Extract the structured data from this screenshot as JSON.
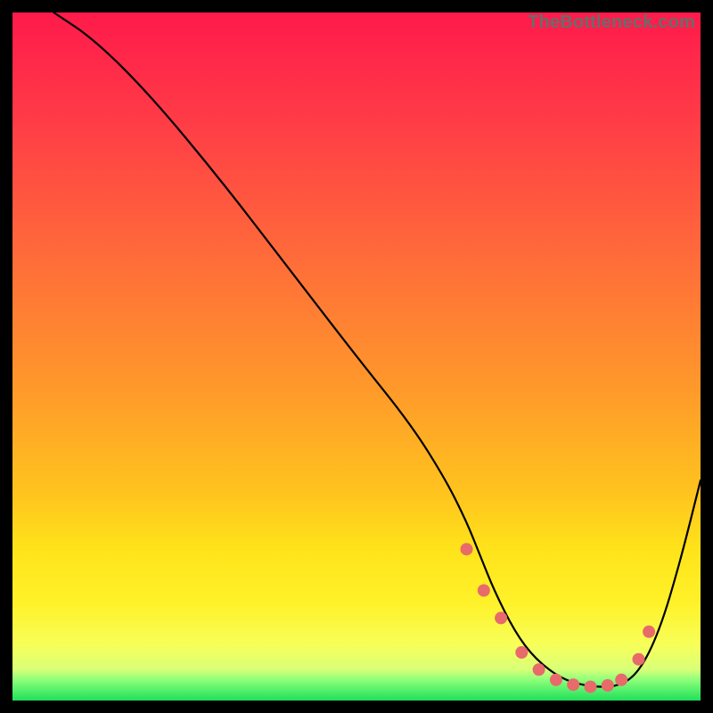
{
  "watermark": "TheBottleneck.com",
  "colors": {
    "gradient": {
      "c0": "#ff1a4b",
      "c1": "#ff3a47",
      "c2": "#ff6a3a",
      "c3": "#ff9a2a",
      "c4": "#ffc41e",
      "c5": "#ffe31a",
      "c6": "#fff22a",
      "c7": "#f7ff5a",
      "c8": "#d8ff78",
      "c9": "#8dff7a",
      "c10": "#1fe05a"
    },
    "marker": "#e86a6a"
  },
  "chart_data": {
    "type": "line",
    "title": "",
    "xlabel": "",
    "ylabel": "",
    "xlim": [
      0,
      100
    ],
    "ylim": [
      0,
      100
    ],
    "grid": false,
    "legend": false,
    "background": "heatmap-gradient red→green vertical",
    "series": [
      {
        "name": "curve",
        "x": [
          6,
          12,
          20,
          30,
          40,
          50,
          58,
          63,
          66,
          68,
          70,
          73,
          76,
          80,
          84,
          88,
          91,
          94,
          97,
          100
        ],
        "y": [
          100,
          96,
          88,
          76,
          63,
          50,
          40,
          32,
          26,
          21,
          16,
          10,
          6,
          3,
          2,
          2,
          4,
          10,
          20,
          32
        ]
      }
    ],
    "markers": {
      "name": "highlight-points",
      "x": [
        66,
        68.5,
        71,
        74,
        76.5,
        79,
        81.5,
        84,
        86.5,
        88.5,
        91,
        92.5
      ],
      "y": [
        22,
        16,
        12,
        7,
        4.5,
        3,
        2.3,
        2,
        2.2,
        3,
        6,
        10
      ]
    }
  }
}
